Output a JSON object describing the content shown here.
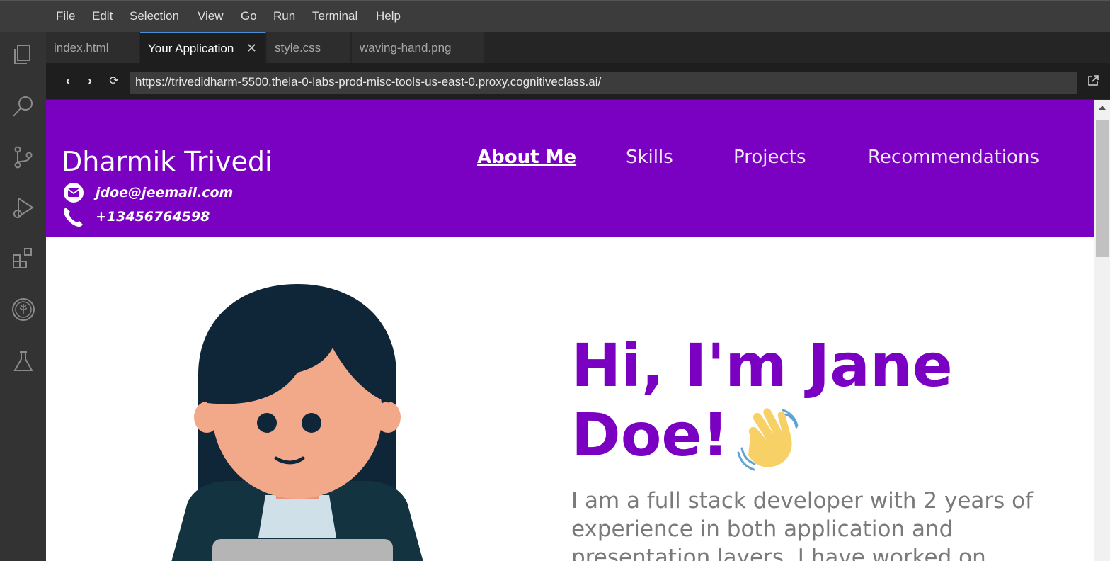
{
  "menu": [
    "File",
    "Edit",
    "Selection",
    "View",
    "Go",
    "Run",
    "Terminal",
    "Help"
  ],
  "activity_icons": [
    "files-icon",
    "search-icon",
    "source-control-icon",
    "run-debug-icon",
    "extensions-icon",
    "tree-icon",
    "flask-icon"
  ],
  "tabs": [
    {
      "label": "index.html"
    },
    {
      "label": "Your Application",
      "active": true,
      "close": "✕"
    },
    {
      "label": "style.css"
    },
    {
      "label": "waving-hand.png"
    }
  ],
  "browser": {
    "url": "https://trivedidharm-5500.theia-0-labs-prod-misc-tools-us-east-0.proxy.cognitiveclass.ai/",
    "back": "‹",
    "forward": "›",
    "reload": "⟳"
  },
  "site": {
    "name": "Dharmik Trivedi",
    "email": "jdoe@jeemail.com",
    "phone": "+13456764598",
    "nav": [
      "About Me",
      "Skills",
      "Projects",
      "Recommendations"
    ],
    "hero_title_1": "Hi, I'm Jane",
    "hero_title_2": "Doe!",
    "hero_text": "I am a full stack developer with 2 years of experience in both application and presentation layers. I have worked on",
    "accent_color": "#7b01c2"
  }
}
